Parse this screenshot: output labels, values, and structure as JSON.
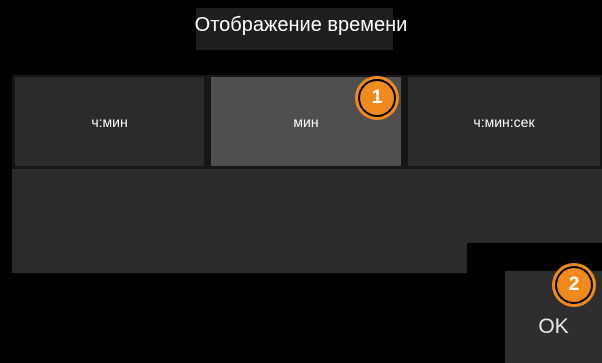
{
  "dialog": {
    "title": "Отображение времени"
  },
  "options": [
    {
      "label": "ч:мин",
      "selected": false
    },
    {
      "label": "мин",
      "selected": true
    },
    {
      "label": "ч:мин:сек",
      "selected": false
    }
  ],
  "ok_label": "OK",
  "callouts": {
    "first": "1",
    "second": "2"
  },
  "colors": {
    "background": "#000000",
    "option": "#2b2b2b",
    "option_selected": "#4f4f4f",
    "callout": "#f08a1c"
  }
}
